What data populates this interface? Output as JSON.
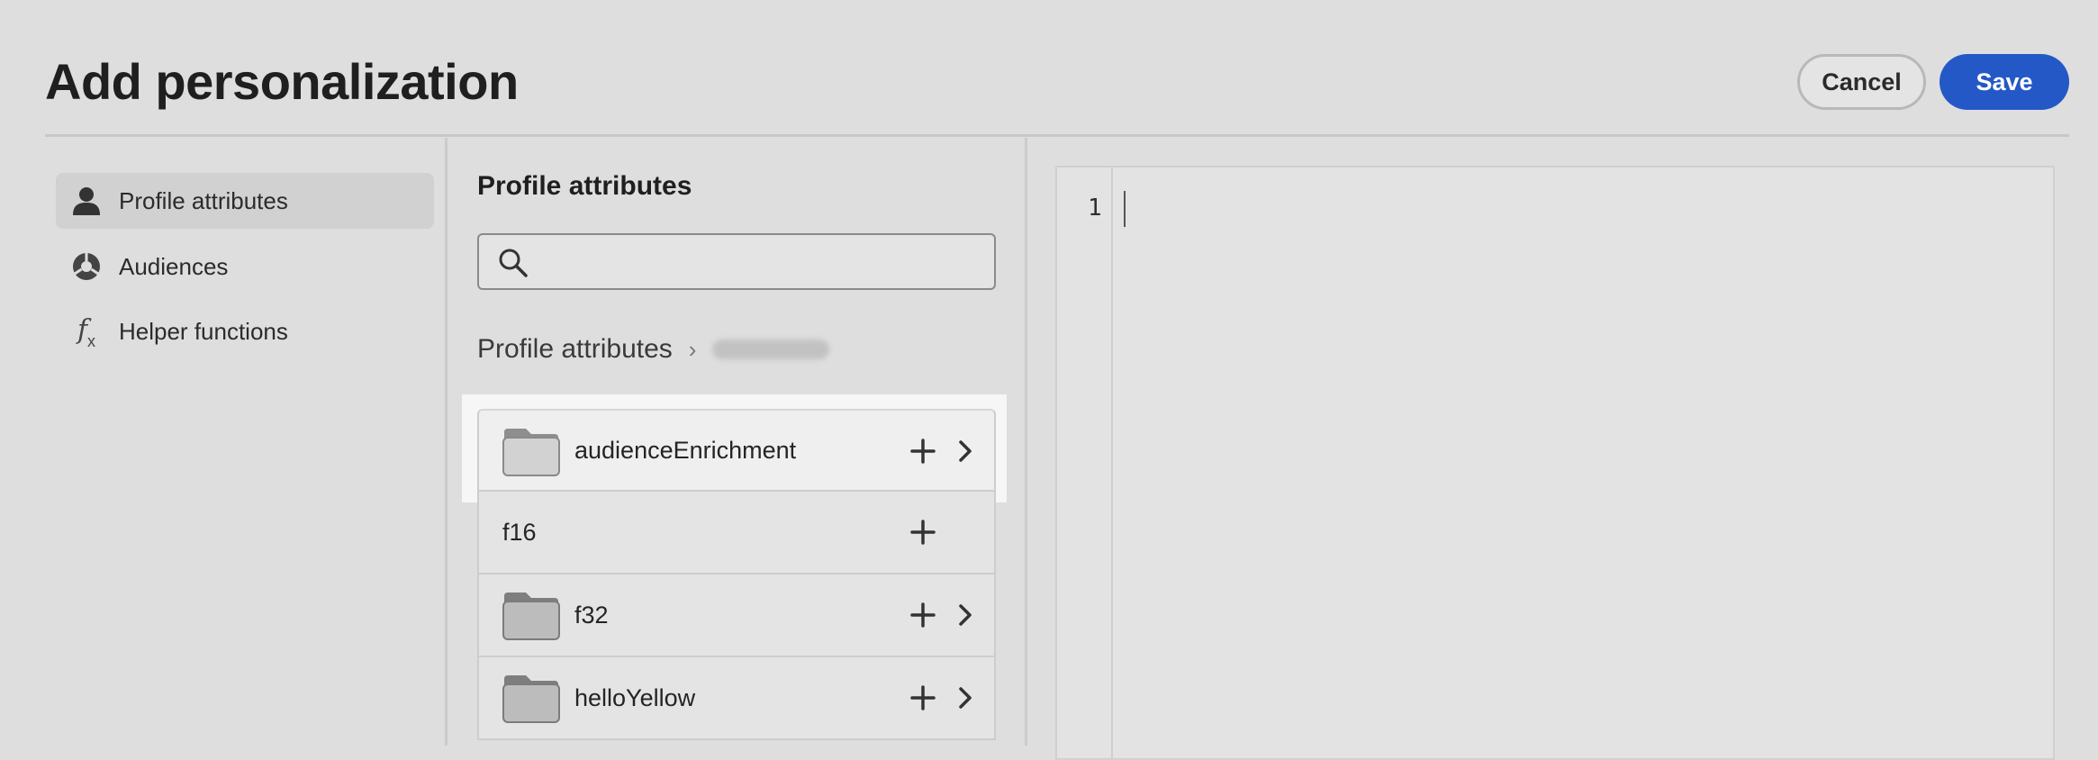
{
  "header": {
    "title": "Add personalization",
    "cancel_label": "Cancel",
    "save_label": "Save"
  },
  "sidebar": {
    "items": [
      {
        "label": "Profile attributes",
        "icon": "person-icon",
        "active": true
      },
      {
        "label": "Audiences",
        "icon": "audiences-icon",
        "active": false
      },
      {
        "label": "Helper functions",
        "icon": "function-icon",
        "active": false
      }
    ]
  },
  "browser": {
    "title": "Profile attributes",
    "search": {
      "value": "",
      "placeholder": ""
    },
    "breadcrumb": {
      "root": "Profile attributes",
      "separator": "›"
    },
    "items": [
      {
        "label": "audienceEnrichment",
        "type": "folder"
      },
      {
        "label": "f16",
        "type": "field"
      },
      {
        "label": "f32",
        "type": "folder"
      },
      {
        "label": "helloYellow",
        "type": "folder"
      }
    ]
  },
  "editor": {
    "line_numbers": [
      "1"
    ]
  },
  "colors": {
    "background": "#dedede",
    "accent": "#2458c7",
    "highlight": "#f6f6f6"
  }
}
